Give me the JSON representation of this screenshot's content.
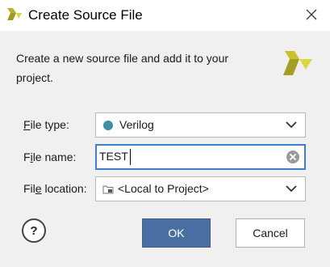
{
  "dialog": {
    "title": "Create Source File",
    "description": "Create a new source file and add it to your project."
  },
  "form": {
    "file_type": {
      "label_accel": "F",
      "label_rest": "ile type:",
      "value": "Verilog",
      "dot_color": "#3f8ea3"
    },
    "file_name": {
      "label_pre": "F",
      "label_accel": "i",
      "label_rest": "le name:",
      "value": "TEST"
    },
    "file_location": {
      "label_pre": "Fil",
      "label_accel": "e",
      "label_rest": " location:",
      "value": "<Local to Project>"
    }
  },
  "buttons": {
    "help": "?",
    "ok": "OK",
    "cancel": "Cancel"
  },
  "colors": {
    "accent": "#4a6ea2",
    "focus": "#3e7fd4",
    "logo": "#c9c32a"
  }
}
